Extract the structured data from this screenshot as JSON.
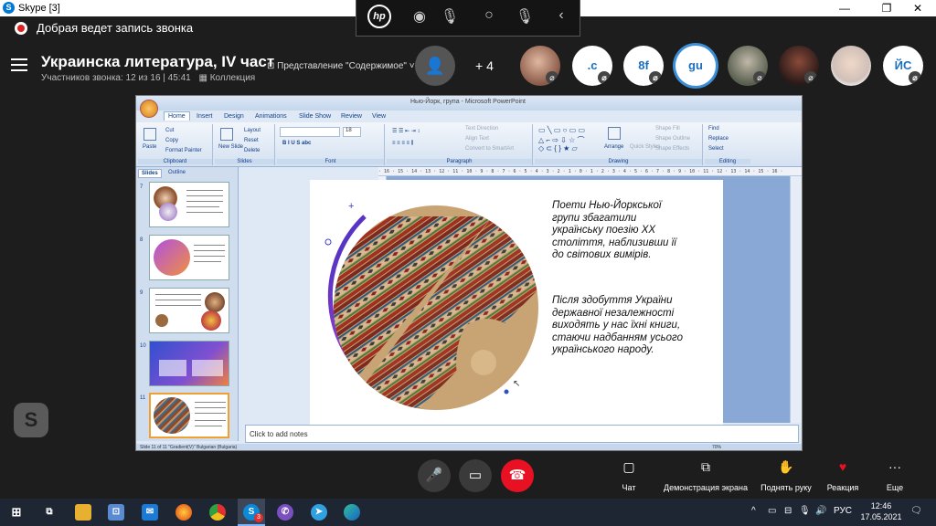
{
  "window": {
    "app_title": "Skype [3]",
    "minimize": "—",
    "maximize": "❐",
    "close": "✕"
  },
  "hp_bar": {
    "logo": "hp"
  },
  "recording": {
    "text": "Добрая ведет запись звонка"
  },
  "call": {
    "title": "Украинска литература, IV част",
    "participants": "Участников звонка: 12 из 16 | 45:41",
    "collection": "Коллекция",
    "content_share": "Представление \"Содержимое\"",
    "more_count": "+ 4",
    "avatars": [
      {
        "type": "photo",
        "label": ""
      },
      {
        "type": "text",
        "label": ".c"
      },
      {
        "type": "text",
        "label": "8f"
      },
      {
        "type": "text",
        "label": "gu"
      },
      {
        "type": "photo",
        "label": ""
      },
      {
        "type": "photo",
        "label": ""
      },
      {
        "type": "photo",
        "label": ""
      },
      {
        "type": "text",
        "label": "ЙС"
      }
    ]
  },
  "ppt": {
    "window_title": "Нью-Йорк, група - Microsoft PowerPoint",
    "tabs": [
      "Home",
      "Insert",
      "Design",
      "Animations",
      "Slide Show",
      "Review",
      "View"
    ],
    "active_tab": "Home",
    "ribbon": {
      "clipboard": {
        "paste": "Paste",
        "cut": "Cut",
        "copy": "Copy",
        "format_painter": "Format Painter",
        "group": "Clipboard"
      },
      "slides": {
        "new_slide": "New Slide",
        "layout": "Layout",
        "reset": "Reset",
        "delete": "Delete",
        "group": "Slides"
      },
      "font": {
        "group": "Font",
        "size": "18"
      },
      "paragraph": {
        "text_direction": "Text Direction",
        "align_text": "Align Text",
        "smartart": "Convert to SmartArt",
        "group": "Paragraph"
      },
      "drawing": {
        "arrange": "Arrange",
        "quick_styles": "Quick Styles",
        "shape_fill": "Shape Fill",
        "shape_outline": "Shape Outline",
        "shape_effects": "Shape Effects",
        "group": "Drawing"
      },
      "editing": {
        "find": "Find",
        "replace": "Replace",
        "select": "Select",
        "group": "Editing"
      }
    },
    "ruler": "· 16 · 15 · 14 · 13 · 12 · 11 · 10 · 9 · 8 · 7 · 6 · 5 · 4 · 3 · 2 · 1 · 0 · 1 · 2 · 3 · 4 · 5 · 6 · 7 · 8 · 9 · 10 · 11 · 12 · 13 · 14 · 15 · 16 ·",
    "thumb_tabs": [
      "Slides",
      "Outline"
    ],
    "slide_numbers": [
      "7",
      "8",
      "9",
      "10",
      "11"
    ],
    "selected_slide": "11",
    "slide_text_1": [
      "Поети Нью-Йоркської",
      "групи збагатили",
      "українську поезію XX",
      "століття, наблизивши її",
      "до світових вимірів."
    ],
    "slide_text_2": [
      "Після здобуття України",
      "державної незалежності",
      "виходять у нас їхні книги,",
      "стаючи надбанням усього",
      "українського народу."
    ],
    "notes_placeholder": "Click to add notes",
    "status": "Slide 11 of 11    \"Gradient(V)\"    Bulgarian (Bulgaria)",
    "zoom": "70%"
  },
  "controls": {
    "chat": "Чат",
    "screen_share": "Демонстрация экрана",
    "raise_hand": "Поднять руку",
    "reaction": "Реакция",
    "more": "Еще"
  },
  "taskbar": {
    "lang": "РУС",
    "time": "12:46",
    "date": "17.05.2021",
    "skype_badge": "3"
  },
  "colors": {
    "accent": "#3a8fd8",
    "end_call": "#e81123",
    "reaction_heart": "#e81123"
  }
}
